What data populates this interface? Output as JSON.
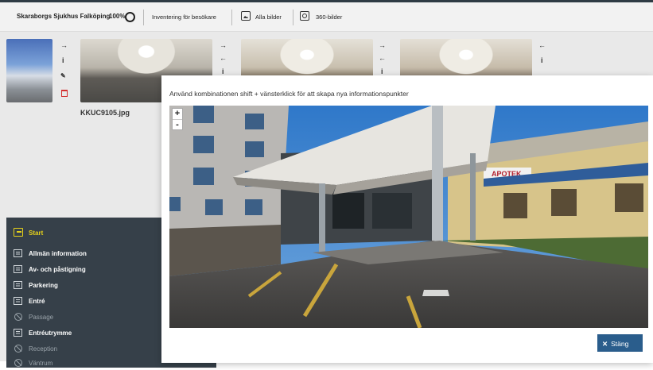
{
  "header": {
    "title": "Skaraborgs Sjukhus Falköping",
    "zoom": "100%",
    "links": [
      "Inventering för besökare",
      "Alla bilder",
      "360-bilder"
    ]
  },
  "thumbnails": {
    "selected_filename": "KKUC9105.jpg"
  },
  "sidebar": {
    "items": [
      {
        "label": "Start",
        "state": "active"
      },
      {
        "label": "Allmän information",
        "state": "normal"
      },
      {
        "label": "Av- och påstigning",
        "state": "normal"
      },
      {
        "label": "Parkering",
        "state": "normal"
      },
      {
        "label": "Entré",
        "state": "normal"
      },
      {
        "label": "Passage",
        "state": "disabled"
      },
      {
        "label": "Entréutrymme",
        "state": "normal"
      },
      {
        "label": "Reception",
        "state": "disabled"
      },
      {
        "label": "Väntrum",
        "state": "disabled"
      }
    ]
  },
  "modal": {
    "instruction": "Använd kombinationen shift + vänsterklick för att skapa nya informationspunkter",
    "zoom_in": "+",
    "zoom_out": "-",
    "close_label": "Stäng",
    "pano_sign": "APOTEK"
  },
  "colors": {
    "sidebar_bg": "#364049",
    "accent_yellow": "#e6d21a",
    "close_button": "#2a5d8c",
    "delete_red": "#d32f2f"
  }
}
